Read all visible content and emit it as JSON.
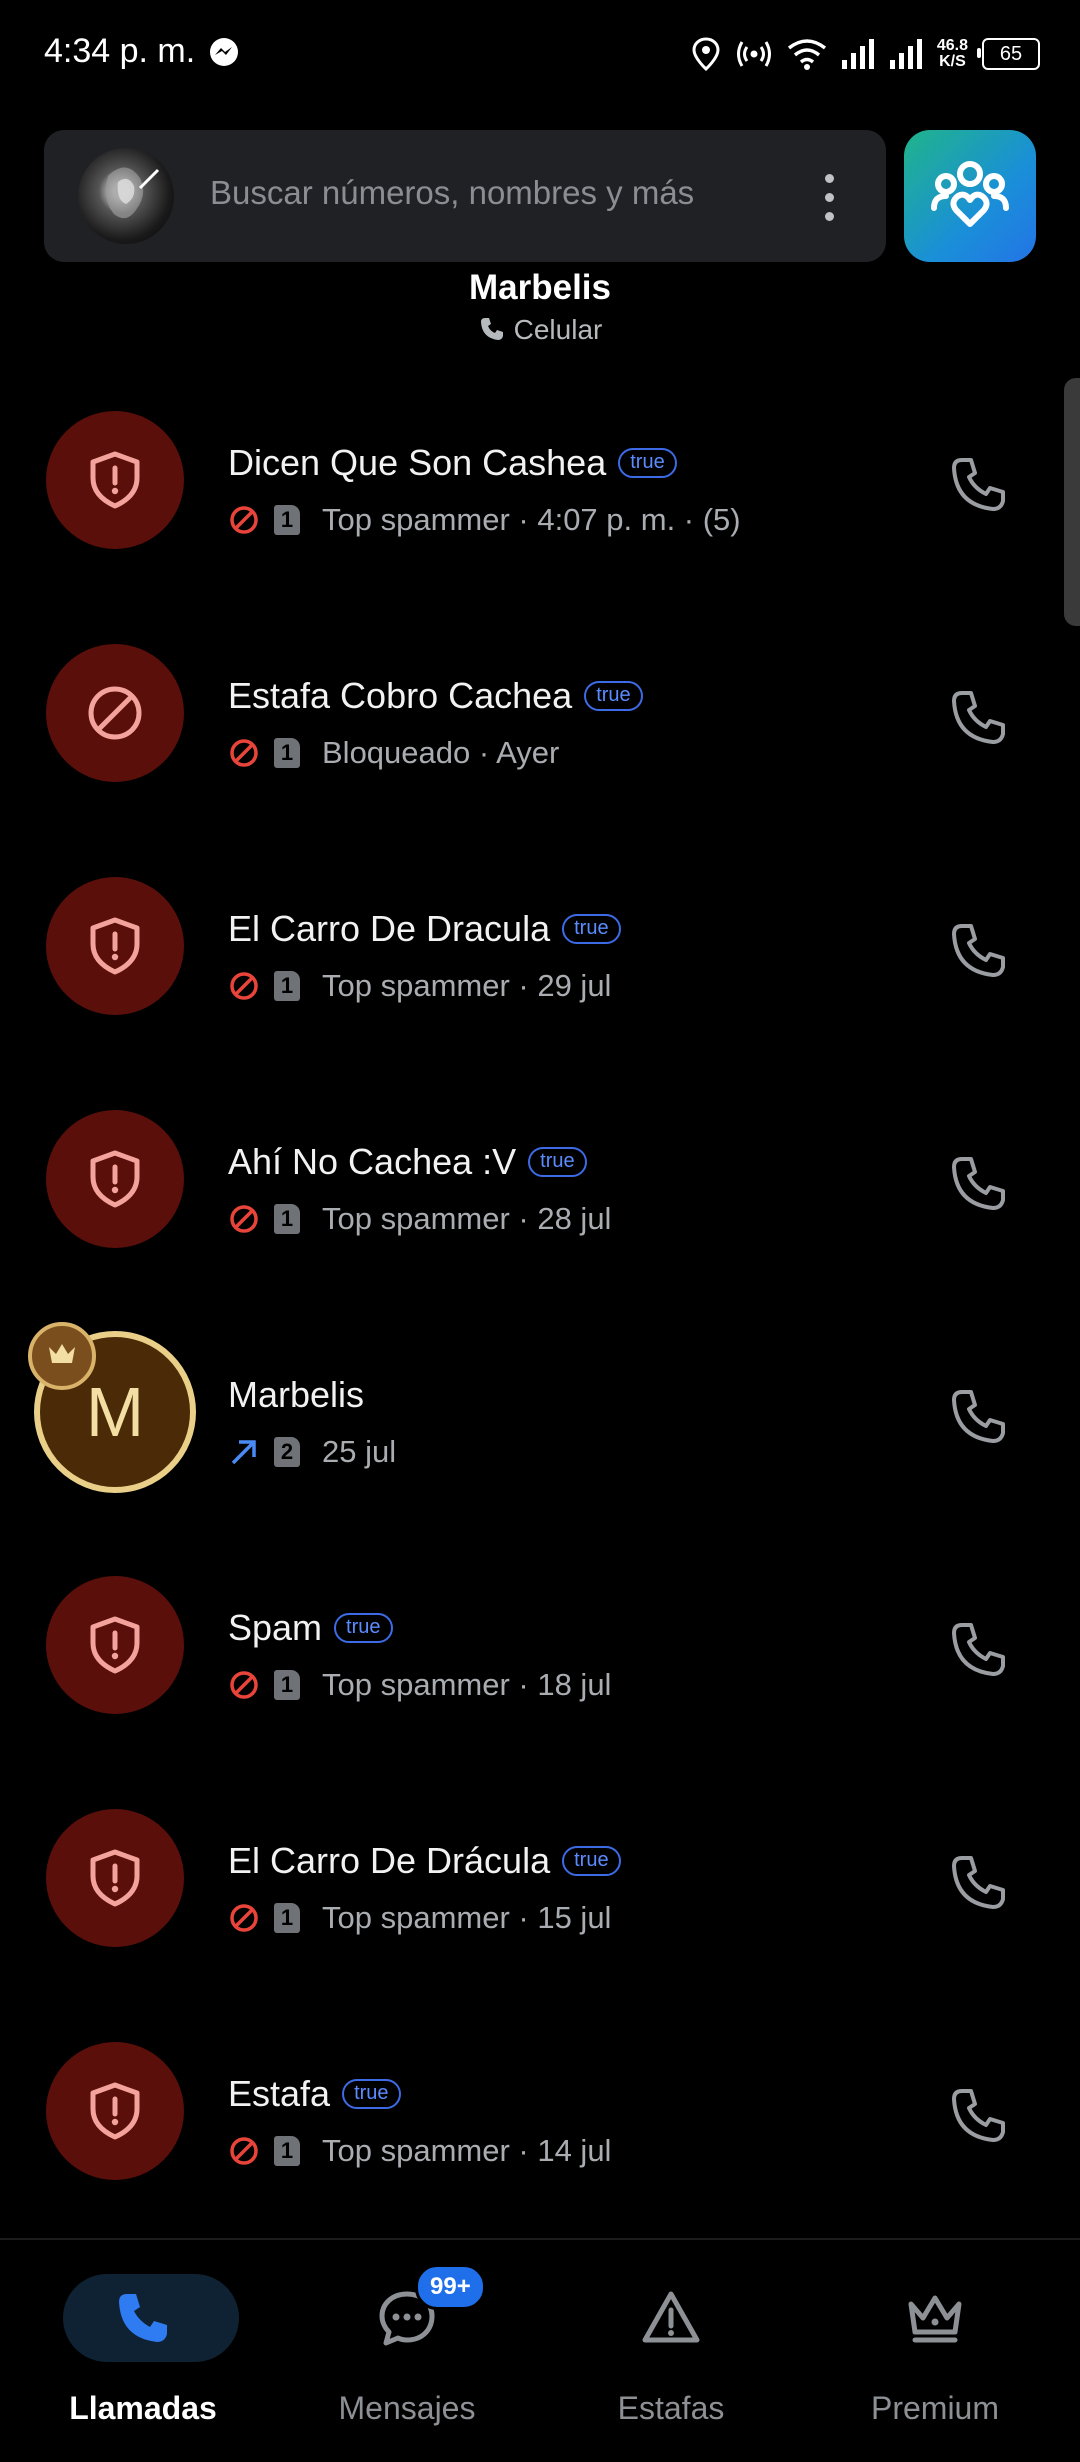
{
  "status_bar": {
    "time": "4:34 p. m.",
    "speed_value": "46.8",
    "speed_unit": "K/S",
    "battery": "65"
  },
  "search": {
    "placeholder": "Buscar números, nombres y más"
  },
  "caller": {
    "name": "Marbelis",
    "type": "Celular"
  },
  "calls": [
    {
      "name": "Dicen Que Son Cashea",
      "tag": "true",
      "status_icon": "block-icon",
      "sim": "1",
      "detail": "Top spammer · 4:07 p. m. · (5)",
      "avatar": "shield-alert-icon"
    },
    {
      "name": "Estafa Cobro Cachea",
      "tag": "true",
      "status_icon": "block-icon",
      "sim": "1",
      "detail": "Bloqueado · Ayer",
      "avatar": "block-icon"
    },
    {
      "name": "El Carro De Dracula",
      "tag": "true",
      "status_icon": "block-icon",
      "sim": "1",
      "detail": "Top spammer · 29 jul",
      "avatar": "shield-alert-icon"
    },
    {
      "name": "Ahí No Cachea :V",
      "tag": "true",
      "status_icon": "block-icon",
      "sim": "1",
      "detail": "Top spammer · 28 jul",
      "avatar": "shield-alert-icon"
    },
    {
      "name": "Marbelis",
      "tag": "",
      "status_icon": "outgoing-arrow-icon",
      "sim": "2",
      "detail": "25 jul",
      "avatar": "M"
    },
    {
      "name": "Spam",
      "tag": "true",
      "status_icon": "block-icon",
      "sim": "1",
      "detail": "Top spammer · 18 jul",
      "avatar": "shield-alert-icon"
    },
    {
      "name": "El Carro De Drácula",
      "tag": "true",
      "status_icon": "block-icon",
      "sim": "1",
      "detail": "Top spammer · 15 jul",
      "avatar": "shield-alert-icon"
    },
    {
      "name": "Estafa",
      "tag": "true",
      "status_icon": "block-icon",
      "sim": "1",
      "detail": "Top spammer · 14 jul",
      "avatar": "shield-alert-icon"
    }
  ],
  "nav": {
    "calls": "Llamadas",
    "messages": "Mensajes",
    "messages_badge": "99+",
    "scams": "Estafas",
    "premium": "Premium"
  },
  "colors": {
    "accent": "#2f7bf2",
    "spam_avatar_bg": "#5a0f0a",
    "tag": "#3d6be6",
    "gold": "#e9cf88"
  }
}
